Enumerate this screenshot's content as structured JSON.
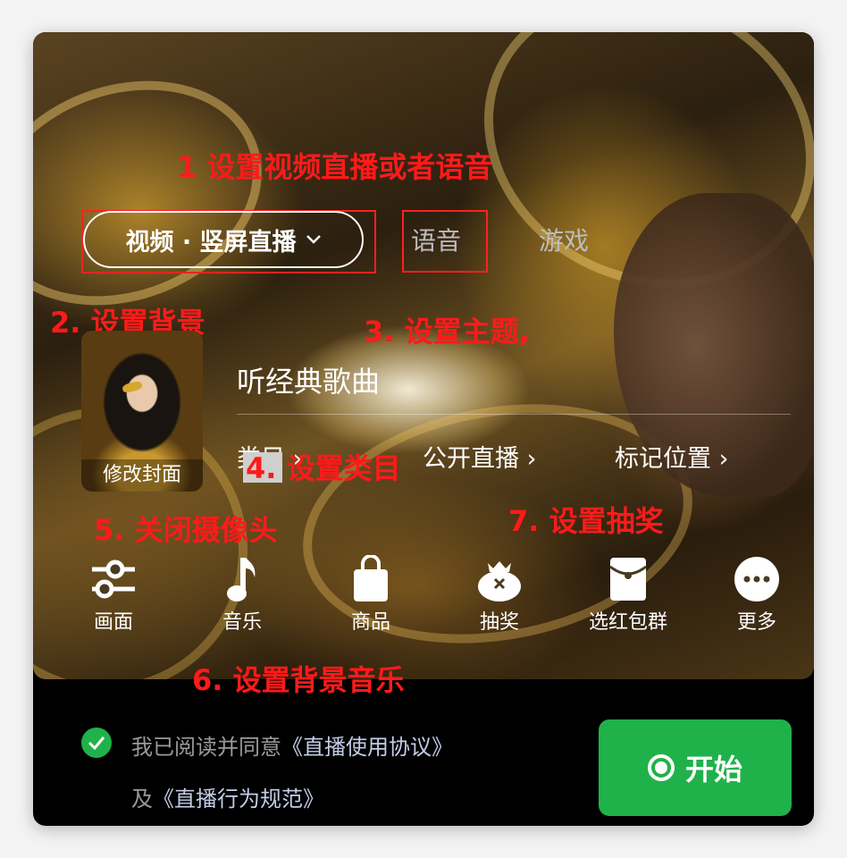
{
  "annotations": {
    "a1": "1 设置视频直播或者语音",
    "a2": "2. 设置背景",
    "a3": "3. 设置主题,",
    "a4": "4. 设置类目",
    "a5": "5. 关闭摄像头",
    "a6": "6. 设置背景音乐",
    "a7": "7. 设置抽奖"
  },
  "mode_tabs": {
    "selected": "视频 · 竖屏直播",
    "voice": "语音",
    "game": "游戏"
  },
  "cover": {
    "label": "修改封面"
  },
  "title_input": {
    "value": "听经典歌曲"
  },
  "options": {
    "category": "类目",
    "public": "公开直播",
    "location": "标记位置"
  },
  "tools": [
    {
      "label": "画面",
      "icon": "sliders-icon"
    },
    {
      "label": "音乐",
      "icon": "music-note-icon"
    },
    {
      "label": "商品",
      "icon": "shopping-bag-icon"
    },
    {
      "label": "抽奖",
      "icon": "lucky-bag-icon"
    },
    {
      "label": "选红包群",
      "icon": "red-envelope-icon"
    },
    {
      "label": "更多",
      "icon": "more-icon"
    }
  ],
  "agreement": {
    "prefix": "我已阅读并同意",
    "link1": "《直播使用协议》",
    "and": "及",
    "link2": "《直播行为规范》"
  },
  "start_button": {
    "label": "开始"
  },
  "colors": {
    "accent_green": "#1fb24a",
    "annotation_red": "#ff1a1a"
  }
}
